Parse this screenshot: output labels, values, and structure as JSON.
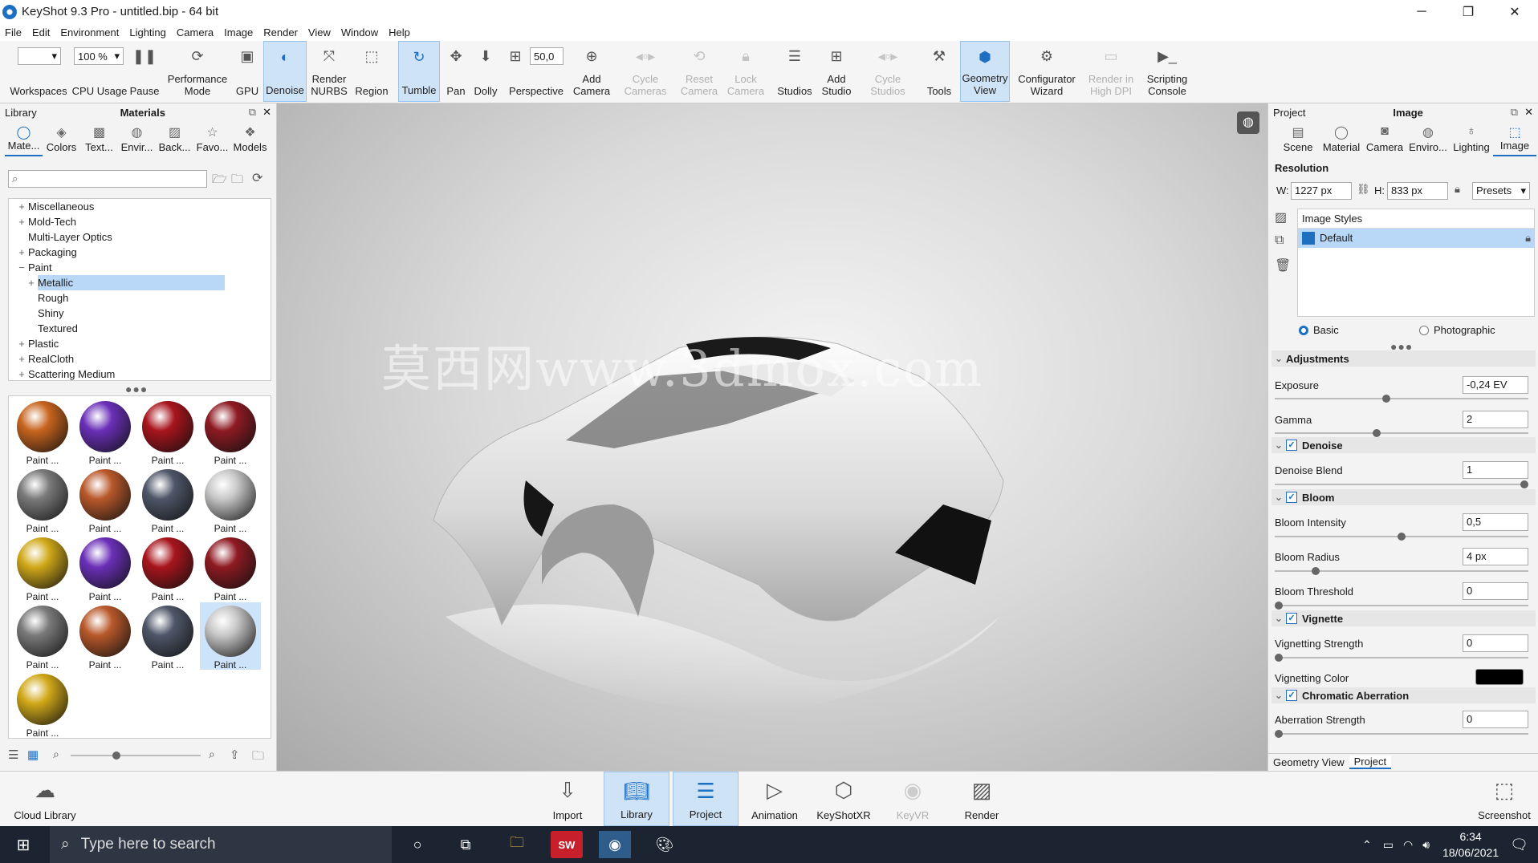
{
  "window": {
    "title": "KeyShot 9.3 Pro  - untitled.bip  - 64 bit",
    "minimize": "─",
    "restore": "❐",
    "close": "✕"
  },
  "menu": [
    "File",
    "Edit",
    "Environment",
    "Lighting",
    "Camera",
    "Image",
    "Render",
    "View",
    "Window",
    "Help"
  ],
  "toolbar": {
    "workspaces": "Workspaces",
    "cpu_usage": "CPU Usage",
    "cpu_value": "100 %",
    "pause": "Pause",
    "performance_mode": "Performance Mode",
    "gpu": "GPU",
    "denoise": "Denoise",
    "render_nurbs": "Render NURBS",
    "region": "Region",
    "tumble": "Tumble",
    "pan": "Pan",
    "dolly": "Dolly",
    "perspective": "Perspective",
    "perspective_value": "50,0",
    "add_camera": "Add Camera",
    "cycle_cameras": "Cycle Cameras",
    "reset_camera": "Reset Camera",
    "lock_camera": "Lock Camera",
    "studios": "Studios",
    "add_studio": "Add Studio",
    "cycle_studios": "Cycle Studios",
    "tools": "Tools",
    "geometry_view": "Geometry View",
    "configurator_wizard": "Configurator Wizard",
    "render_high_dpi": "Render in High DPI",
    "scripting_console": "Scripting Console"
  },
  "library": {
    "panel_title": "Library",
    "header": "Materials",
    "tabs": [
      "Mate...",
      "Colors",
      "Text...",
      "Envir...",
      "Back...",
      "Favo...",
      "Models"
    ],
    "search_placeholder": "",
    "tree": [
      {
        "label": "Miscellaneous",
        "expander": "+",
        "indent": 0
      },
      {
        "label": "Mold-Tech",
        "expander": "+",
        "indent": 0
      },
      {
        "label": "Multi-Layer Optics",
        "expander": "",
        "indent": 0
      },
      {
        "label": "Packaging",
        "expander": "+",
        "indent": 0
      },
      {
        "label": "Paint",
        "expander": "−",
        "indent": 0
      },
      {
        "label": "Metallic",
        "expander": "+",
        "indent": 1,
        "selected": true
      },
      {
        "label": "Rough",
        "expander": "",
        "indent": 1
      },
      {
        "label": "Shiny",
        "expander": "",
        "indent": 1
      },
      {
        "label": "Textured",
        "expander": "",
        "indent": 1
      },
      {
        "label": "Plastic",
        "expander": "+",
        "indent": 0
      },
      {
        "label": "RealCloth",
        "expander": "+",
        "indent": 0
      },
      {
        "label": "Scattering Medium",
        "expander": "+",
        "indent": 0
      }
    ],
    "thumbnails": [
      {
        "label": "Paint ...",
        "color": "#c8641e"
      },
      {
        "label": "Paint ...",
        "color": "#6a2fb8"
      },
      {
        "label": "Paint ...",
        "color": "#a8141c"
      },
      {
        "label": "Paint ...",
        "color": "#8e1a22"
      },
      {
        "label": "Paint ...",
        "color": "#7a7a7a"
      },
      {
        "label": "Paint ...",
        "color": "#b8582a"
      },
      {
        "label": "Paint ...",
        "color": "#4e5668"
      },
      {
        "label": "Paint ...",
        "color": "#c8c8c8"
      },
      {
        "label": "Paint ...",
        "color": "#d0a818"
      },
      {
        "label": "Paint ...",
        "color": "#6a2fb8"
      },
      {
        "label": "Paint ...",
        "color": "#a8141c"
      },
      {
        "label": "Paint ...",
        "color": "#8e1a22"
      },
      {
        "label": "Paint ...",
        "color": "#7a7a7a"
      },
      {
        "label": "Paint ...",
        "color": "#b8582a"
      },
      {
        "label": "Paint ...",
        "color": "#4e5668"
      },
      {
        "label": "Paint ...",
        "color": "#c8c8c8",
        "selected": true
      },
      {
        "label": "Paint ...",
        "color": "#d0a818"
      }
    ]
  },
  "viewport": {
    "watermark": "莫西网www.3dmox.com"
  },
  "project": {
    "panel_title": "Project",
    "header": "Image",
    "tabs": [
      "Scene",
      "Material",
      "Camera",
      "Enviro...",
      "Lighting",
      "Image"
    ],
    "resolution_label": "Resolution",
    "w_label": "W:",
    "w_value": "1227 px",
    "h_label": "H:",
    "h_value": "833 px",
    "presets": "Presets",
    "image_styles_label": "Image Styles",
    "image_style_default": "Default",
    "mode_basic": "Basic",
    "mode_photographic": "Photographic",
    "adjustments": "Adjustments",
    "exposure_label": "Exposure",
    "exposure_value": "-0,24 EV",
    "gamma_label": "Gamma",
    "gamma_value": "2",
    "denoise": "Denoise",
    "denoise_blend_label": "Denoise Blend",
    "denoise_blend_value": "1",
    "bloom": "Bloom",
    "bloom_intensity_label": "Bloom Intensity",
    "bloom_intensity_value": "0,5",
    "bloom_radius_label": "Bloom Radius",
    "bloom_radius_value": "4 px",
    "bloom_threshold_label": "Bloom Threshold",
    "bloom_threshold_value": "0",
    "vignette": "Vignette",
    "vignetting_strength_label": "Vignetting Strength",
    "vignetting_strength_value": "0",
    "vignetting_color_label": "Vignetting Color",
    "vignetting_color": "#000000",
    "chromatic_aberration": "Chromatic Aberration",
    "aberration_strength_label": "Aberration Strength",
    "aberration_strength_value": "0",
    "bottom_tabs": [
      "Geometry View",
      "Project"
    ]
  },
  "bottombar": {
    "cloud_library": "Cloud Library",
    "import": "Import",
    "library": "Library",
    "project": "Project",
    "animation": "Animation",
    "keyshotxr": "KeyShotXR",
    "keyvr": "KeyVR",
    "render": "Render",
    "screenshot": "Screenshot"
  },
  "taskbar": {
    "search_placeholder": "Type here to search",
    "time": "6:34",
    "date": "18/06/2021"
  },
  "colors": {
    "accent": "#1d6fc2",
    "selection": "#b9d8f7",
    "taskbar": "#1b2430"
  }
}
